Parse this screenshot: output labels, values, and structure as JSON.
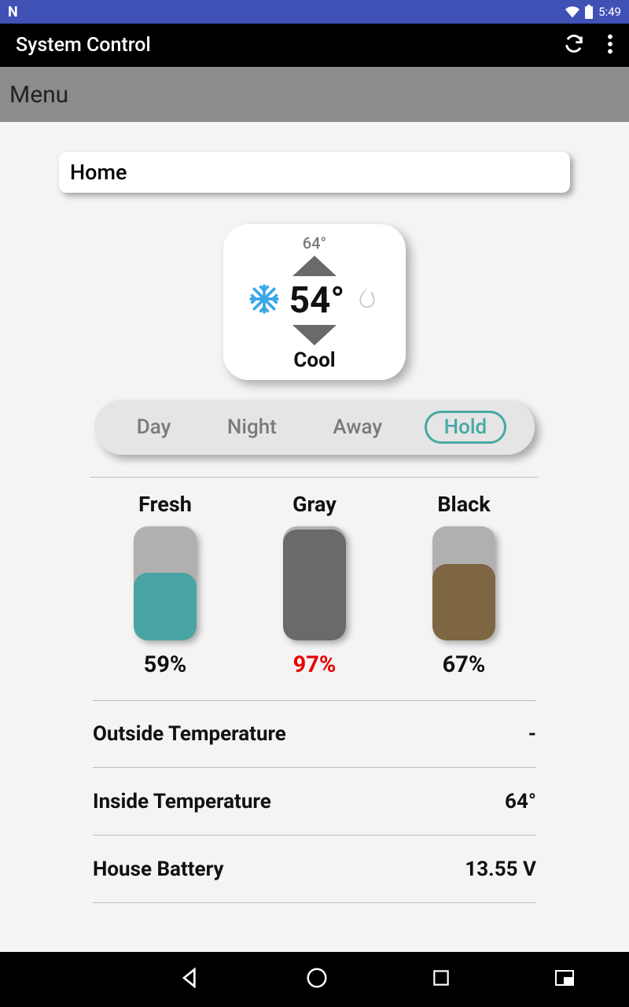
{
  "status": {
    "time": "5:49"
  },
  "appbar": {
    "title": "System Control"
  },
  "menubar": {
    "label": "Menu"
  },
  "location": {
    "label": "Home"
  },
  "thermostat": {
    "target": "64°",
    "current": "54°",
    "mode": "Cool"
  },
  "modes": {
    "day": "Day",
    "night": "Night",
    "away": "Away",
    "hold": "Hold"
  },
  "tanks": [
    {
      "label": "Fresh",
      "pct": "59%",
      "fill": 59,
      "color": "#49a3a3",
      "warn": false
    },
    {
      "label": "Gray",
      "pct": "97%",
      "fill": 97,
      "color": "#6a6a6a",
      "warn": true
    },
    {
      "label": "Black",
      "pct": "67%",
      "fill": 67,
      "color": "#7d6641",
      "warn": false
    }
  ],
  "stats": [
    {
      "label": "Outside Temperature",
      "value": "-"
    },
    {
      "label": "Inside Temperature",
      "value": "64°"
    },
    {
      "label": "House Battery",
      "value": "13.55 V"
    }
  ]
}
